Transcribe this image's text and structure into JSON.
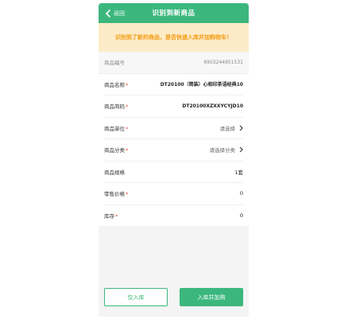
{
  "header": {
    "back_label": "返回",
    "title": "识别到新商品"
  },
  "notice": {
    "text": "识别到了新的商品，是否快速入库并加购物车！"
  },
  "form": {
    "barcode": {
      "label": "商品编号",
      "value": "6903244951531"
    },
    "name": {
      "label": "商品名称",
      "required": "*",
      "value": "DT20100（简装）心相印茶语经典10"
    },
    "short_code": {
      "label": "商品简码",
      "required": "*",
      "value": "DT20100XZXXYCYJD10"
    },
    "unit": {
      "label": "商品单位",
      "required": "*",
      "value": "请选择"
    },
    "category": {
      "label": "商品分类",
      "required": "*",
      "value": "请选择分类"
    },
    "spec": {
      "label": "商品规格",
      "value": "1套"
    },
    "retail_price": {
      "label": "零售价格",
      "required": "*",
      "value": "0"
    },
    "stock": {
      "label": "库存",
      "required": "*",
      "value": "0"
    }
  },
  "actions": {
    "stock_only_label": "仅入库",
    "stock_and_cart_label": "入库并加购"
  },
  "colors": {
    "brand": "#3bb77e",
    "notice_bg": "#fdebc8",
    "notice_text": "#f39c12",
    "required": "#e74c3c"
  }
}
